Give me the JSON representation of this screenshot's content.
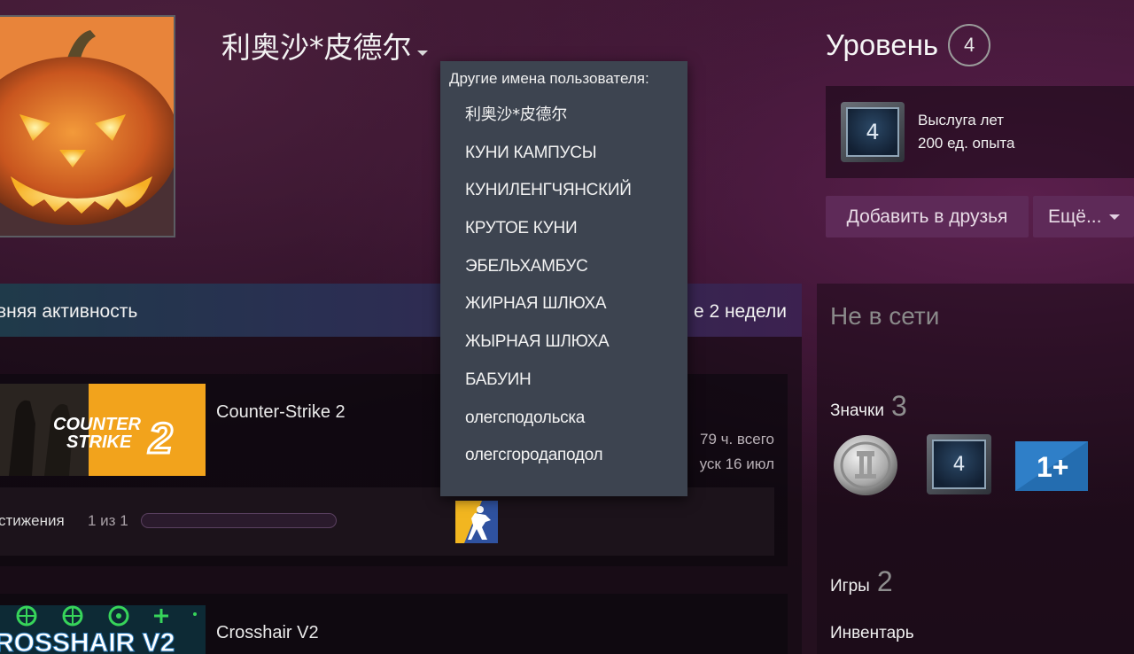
{
  "profile": {
    "persona_name": "利奥沙*皮德尔"
  },
  "level": {
    "label": "Уровень",
    "value": "4"
  },
  "service_badge": {
    "icon_value": "4",
    "title": "Выслуга лет",
    "xp": "200 ед. опыта"
  },
  "actions": {
    "add_friend": "Добавить в друзья",
    "more": "Ещё..."
  },
  "activity": {
    "title": "вняя активность",
    "period": "е 2 недели",
    "games": [
      {
        "name": "Counter-Strike 2",
        "hours": "79 ч. всего",
        "last_played": "уск 16 июл",
        "achievements_label": "стижения",
        "achievements_count": "1 из 1",
        "achievements_progress": 0.0,
        "capsule_text_line1": "COUNTER",
        "capsule_text_line2": "STRIKE",
        "capsule_number": "2"
      },
      {
        "name": "Crosshair V2",
        "capsule_text": "ROSSHAIR V2"
      }
    ]
  },
  "sidebar": {
    "status": "Не в сети",
    "badges_label": "Значки",
    "badges_count": "3",
    "years_badge_value": "4",
    "oneplus_badge_text": "1+",
    "games_label": "Игры",
    "games_count": "2",
    "inventory_label": "Инвентарь"
  },
  "aliases_dropdown": {
    "heading": "Другие имена пользователя:",
    "items": [
      "利奥沙*皮德尔",
      "КУНИ КАМПУСЫ",
      "КУНИЛЕНГЧЯНСКИЙ",
      "КРУТОЕ КУНИ",
      "ЭБЕЛЬХАМБУС",
      "ЖИРНАЯ ШЛЮХА",
      "ЖЫРНАЯ ШЛЮХА",
      "БАБУИН",
      "олегсподольска",
      "олегсгородаподол"
    ]
  },
  "colors": {
    "button_bg": "#5e2a58",
    "dropdown_bg": "#3d4450"
  }
}
